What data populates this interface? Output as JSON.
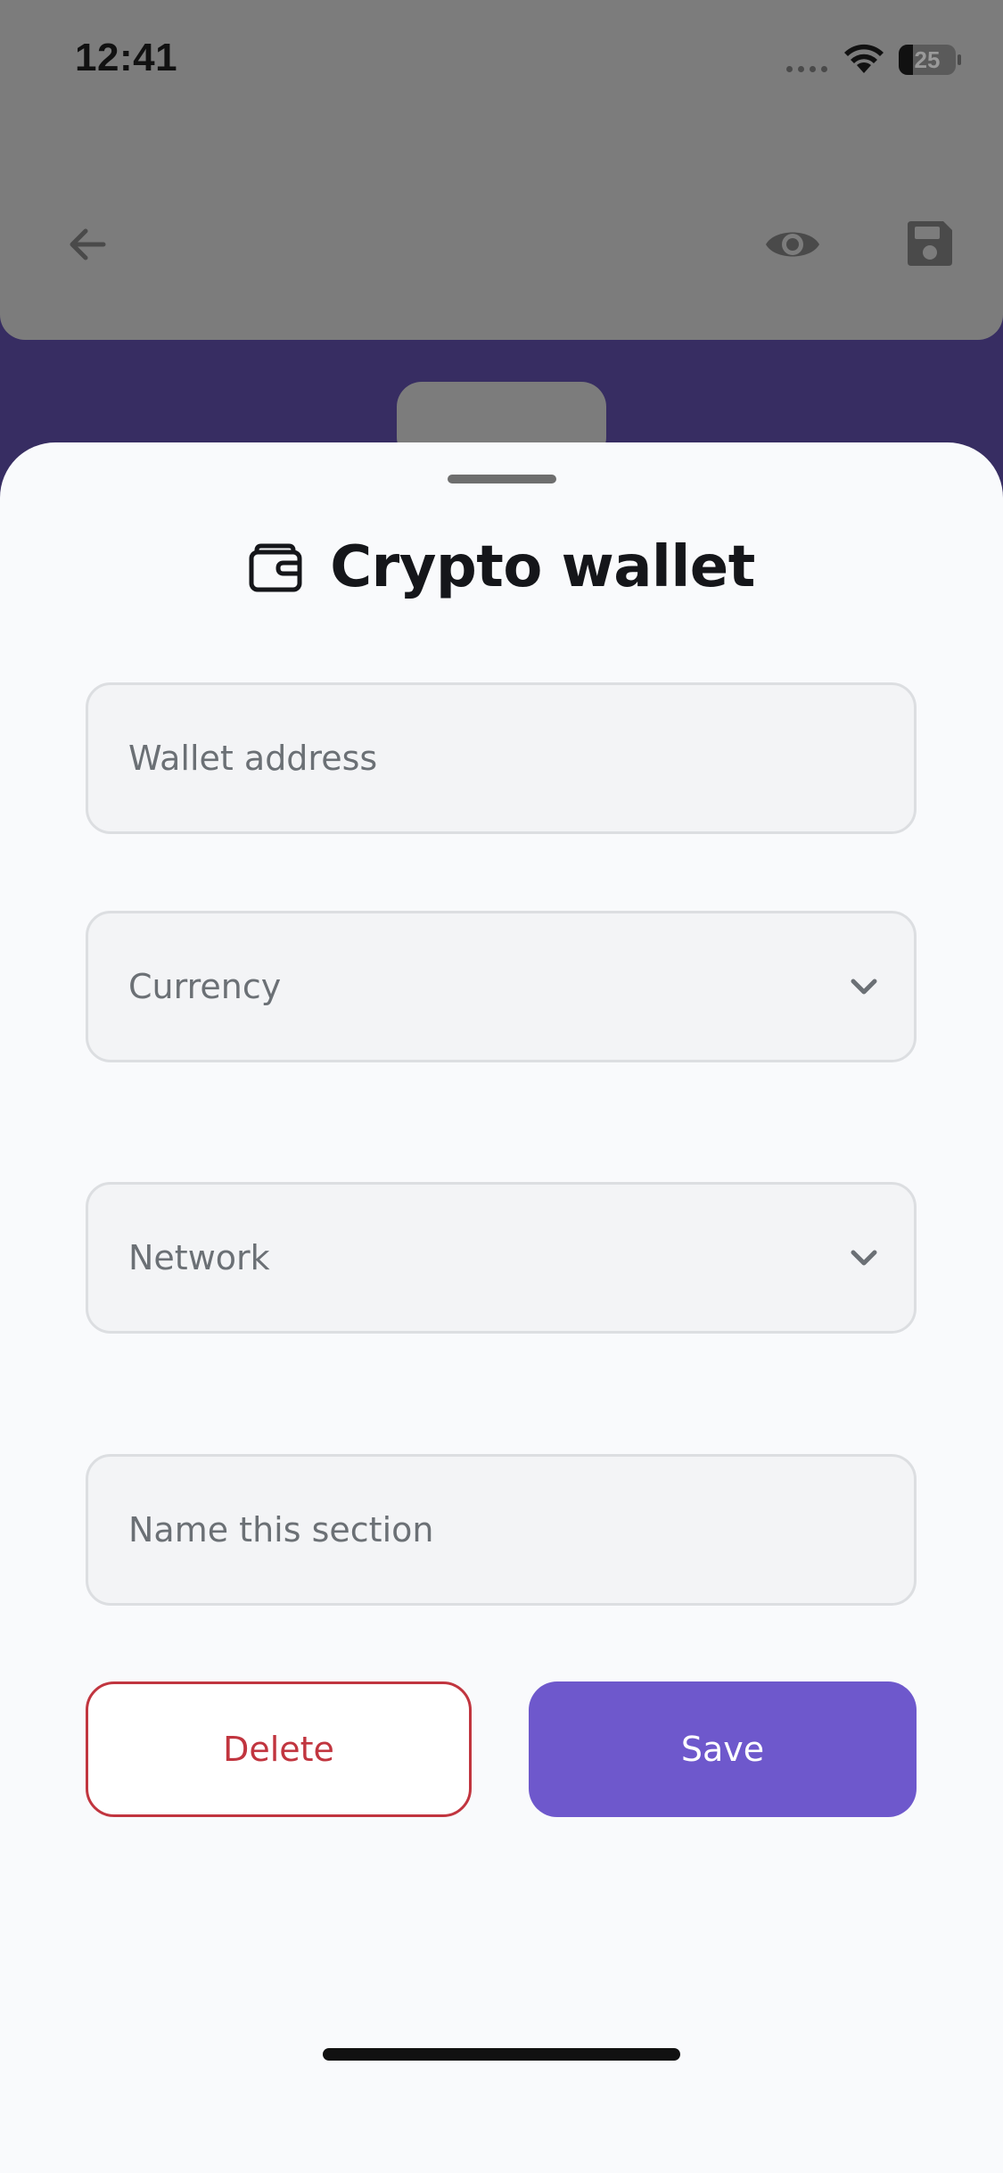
{
  "status_bar": {
    "time": "12:41",
    "battery_level": "25",
    "battery_fraction": 0.25
  },
  "background_app": {
    "icons": [
      "back-arrow-icon",
      "eye-icon",
      "save-icon"
    ]
  },
  "sheet": {
    "title": "Crypto wallet",
    "title_icon": "wallet-icon",
    "fields": {
      "wallet_address": {
        "placeholder": "Wallet address"
      },
      "currency": {
        "placeholder": "Currency",
        "icon": "chevron-down-icon"
      },
      "network": {
        "placeholder": "Network",
        "icon": "chevron-down-icon"
      },
      "section_name": {
        "placeholder": "Name this section"
      }
    },
    "buttons": {
      "delete_label": "Delete",
      "save_label": "Save"
    }
  },
  "colors": {
    "accent": "#6E58CC",
    "danger": "#C1353F",
    "backdrop": "#372D62",
    "sheet_background": "#F9FAFC"
  }
}
